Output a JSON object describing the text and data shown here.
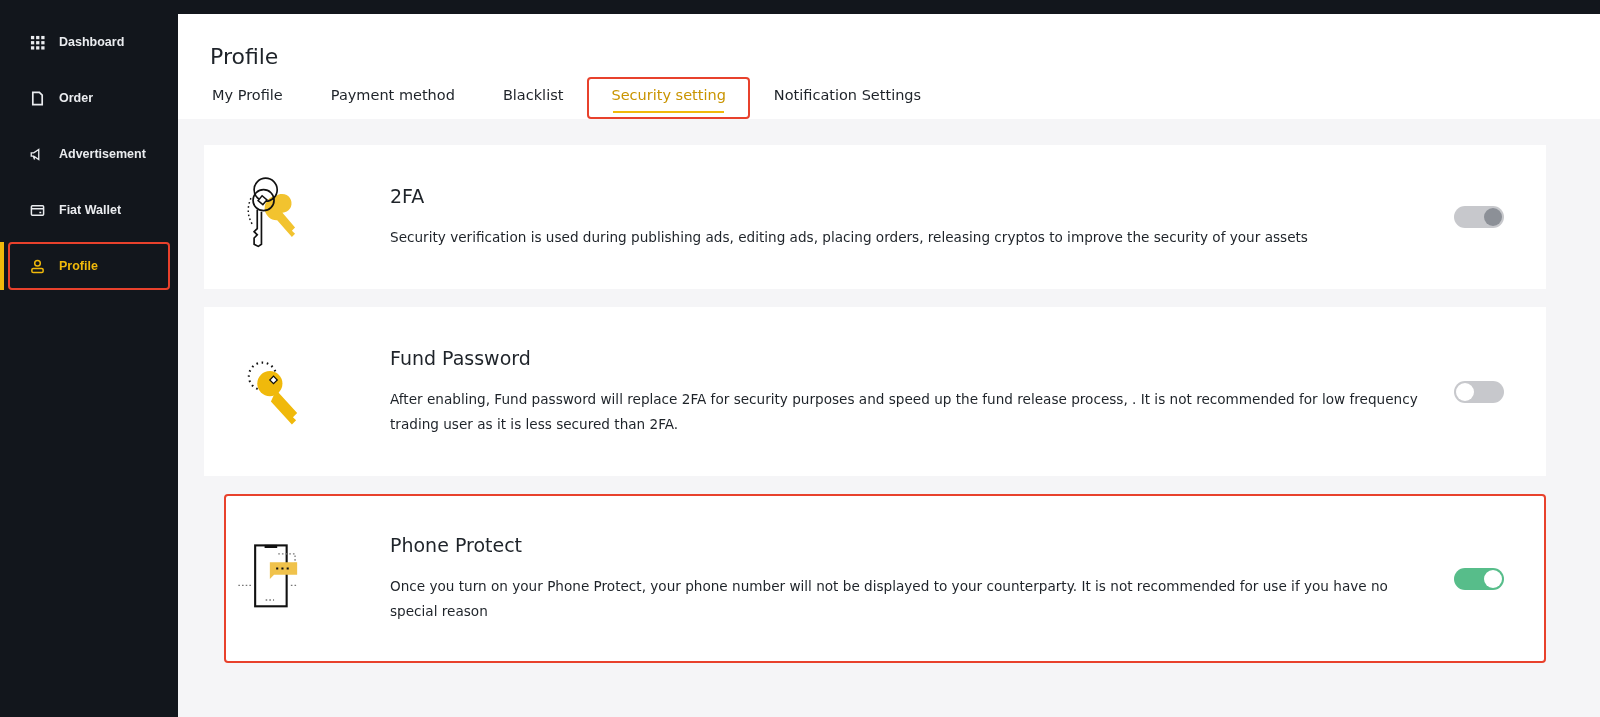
{
  "sidebar": {
    "items": [
      {
        "label": "Dashboard",
        "kind": "grid",
        "selected": false,
        "highlighted": false
      },
      {
        "label": "Order",
        "kind": "document",
        "selected": false,
        "highlighted": false
      },
      {
        "label": "Advertisement",
        "kind": "megaphone",
        "selected": false,
        "highlighted": false
      },
      {
        "label": "Fiat Wallet",
        "kind": "wallet",
        "selected": false,
        "highlighted": false
      },
      {
        "label": "Profile",
        "kind": "person",
        "selected": true,
        "highlighted": true
      }
    ]
  },
  "page": {
    "title": "Profile"
  },
  "tabs": [
    {
      "label": "My Profile",
      "selected": false,
      "highlighted": false
    },
    {
      "label": "Payment method",
      "selected": false,
      "highlighted": false
    },
    {
      "label": "Blacklist",
      "selected": false,
      "highlighted": false
    },
    {
      "label": "Security setting",
      "selected": true,
      "highlighted": true
    },
    {
      "label": "Notification Settings",
      "selected": false,
      "highlighted": false
    }
  ],
  "settings": [
    {
      "kind": "keys",
      "title": "2FA",
      "description": "Security verification is used during publishing ads, editing ads, placing orders, releasing cryptos to improve the security of your assets",
      "on": true,
      "disabled": true,
      "highlighted": false
    },
    {
      "kind": "key",
      "title": "Fund Password",
      "description": "After enabling, Fund password will replace 2FA for security purposes and speed up the fund release process, . It is not recommended for low frequency trading user as it is less secured than 2FA.",
      "on": false,
      "disabled": false,
      "highlighted": false
    },
    {
      "kind": "phone",
      "title": "Phone Protect",
      "description": "Once you turn on your Phone Protect, your phone number will not be displayed to your counterparty. It is not recommended for use if you have no special reason",
      "on": true,
      "disabled": false,
      "highlighted": true
    }
  ]
}
